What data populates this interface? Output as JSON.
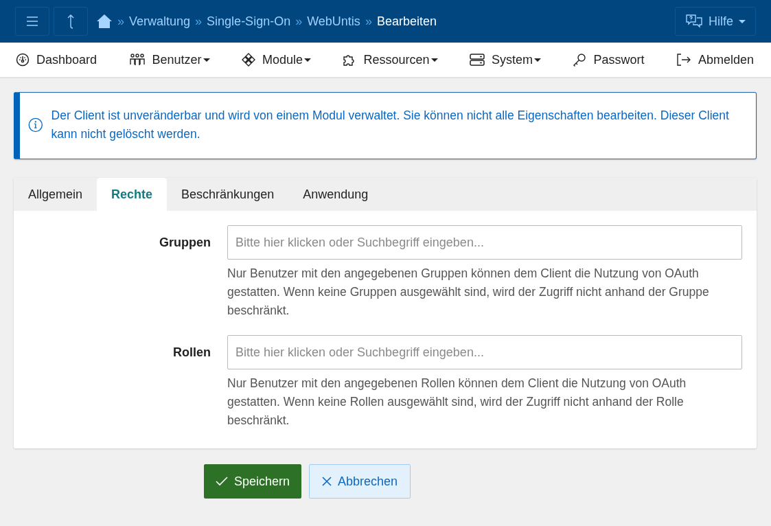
{
  "topbar": {
    "separator": "»",
    "breadcrumb": [
      {
        "label": "Verwaltung",
        "current": false
      },
      {
        "label": "Single-Sign-On",
        "current": false
      },
      {
        "label": "WebUntis",
        "current": false
      },
      {
        "label": "Bearbeiten",
        "current": true
      }
    ],
    "help": "Hilfe"
  },
  "nav": [
    {
      "label": "Dashboard",
      "dropdown": false
    },
    {
      "label": "Benutzer",
      "dropdown": true
    },
    {
      "label": "Module",
      "dropdown": true
    },
    {
      "label": "Ressourcen",
      "dropdown": true
    },
    {
      "label": "System",
      "dropdown": true
    },
    {
      "label": "Passwort",
      "dropdown": false
    },
    {
      "label": "Abmelden",
      "dropdown": false
    }
  ],
  "alert": {
    "text": "Der Client ist unveränderbar und wird von einem Modul verwaltet. Sie können nicht alle Eigenschaften bearbeiten. Dieser Client kann nicht gelöscht werden."
  },
  "tabs": [
    {
      "label": "Allgemein",
      "selected": false
    },
    {
      "label": "Rechte",
      "selected": true
    },
    {
      "label": "Beschränkungen",
      "selected": false
    },
    {
      "label": "Anwendung",
      "selected": false
    }
  ],
  "fields": [
    {
      "label": "Gruppen",
      "placeholder": "Bitte hier klicken oder Suchbegriff eingeben...",
      "help": "Nur Benutzer mit den angegebenen Gruppen können dem Client die Nutzung von OAuth gestatten. Wenn keine Gruppen ausgewählt sind, wird der Zugriff nicht anhand der Gruppe beschränkt."
    },
    {
      "label": "Rollen",
      "placeholder": "Bitte hier klicken oder Suchbegriff eingeben...",
      "help": "Nur Benutzer mit den angegebenen Rollen können dem Client die Nutzung von OAuth gestatten. Wenn keine Rollen ausgewählt sind, wird der Zugriff nicht anhand der Rolle beschränkt."
    }
  ],
  "buttons": [
    {
      "kind": "primary",
      "label": "Speichern"
    },
    {
      "kind": "secondary",
      "label": "Abbrechen"
    }
  ]
}
